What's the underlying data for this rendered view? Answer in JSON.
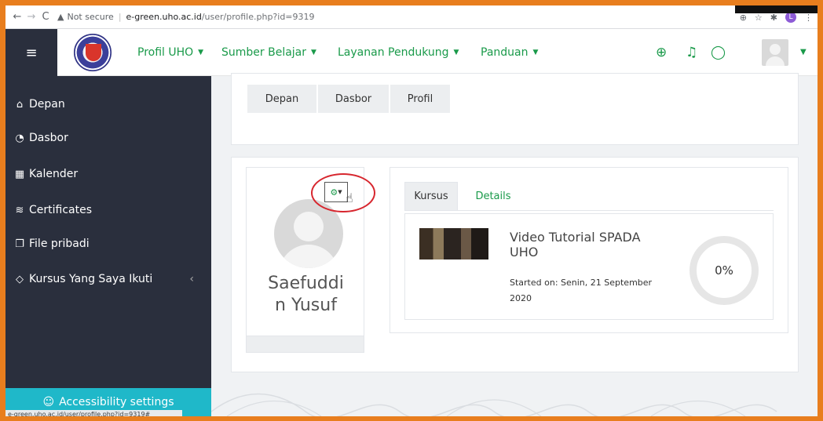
{
  "browser": {
    "back": "←",
    "forward": "→",
    "reload": "C",
    "security_label": "Not secure",
    "url_host": "e-green.uho.ac.id",
    "url_path": "/user/profile.php?id=9319",
    "status_url": "e-green.uho.ac.id/user/profile.php?id=9319#"
  },
  "navbar": {
    "menu_items": [
      {
        "label": "Profil UHO"
      },
      {
        "label": "Sumber Belajar"
      },
      {
        "label": "Layanan Pendukung"
      },
      {
        "label": "Panduan"
      }
    ],
    "accent_color": "#1a9a4a"
  },
  "sidebar": {
    "items": [
      {
        "label": "Depan",
        "icon": "home-icon"
      },
      {
        "label": "Dasbor",
        "icon": "dashboard-icon"
      },
      {
        "label": "Kalender",
        "icon": "calendar-icon"
      },
      {
        "label": "Certificates",
        "icon": "certificate-icon"
      },
      {
        "label": "File pribadi",
        "icon": "files-icon"
      },
      {
        "label": "Kursus Yang Saya Ikuti",
        "icon": "graduation-cap-icon"
      }
    ],
    "accessibility_label": "Accessibility settings",
    "background": "#2a2f3d"
  },
  "breadcrumb": [
    "Depan",
    "Dasbor",
    "Profil"
  ],
  "profile": {
    "name_line1": "Saefuddi",
    "name_line2": "n Yusuf"
  },
  "tabs": [
    {
      "label": "Kursus",
      "active": true
    },
    {
      "label": "Details",
      "active": false
    }
  ],
  "course": {
    "title_line1": "Video Tutorial SPADA",
    "title_line2": "UHO",
    "started_line1": "Started on: Senin, 21 September",
    "started_line2": "2020",
    "progress_label": "0%",
    "progress": 0
  }
}
